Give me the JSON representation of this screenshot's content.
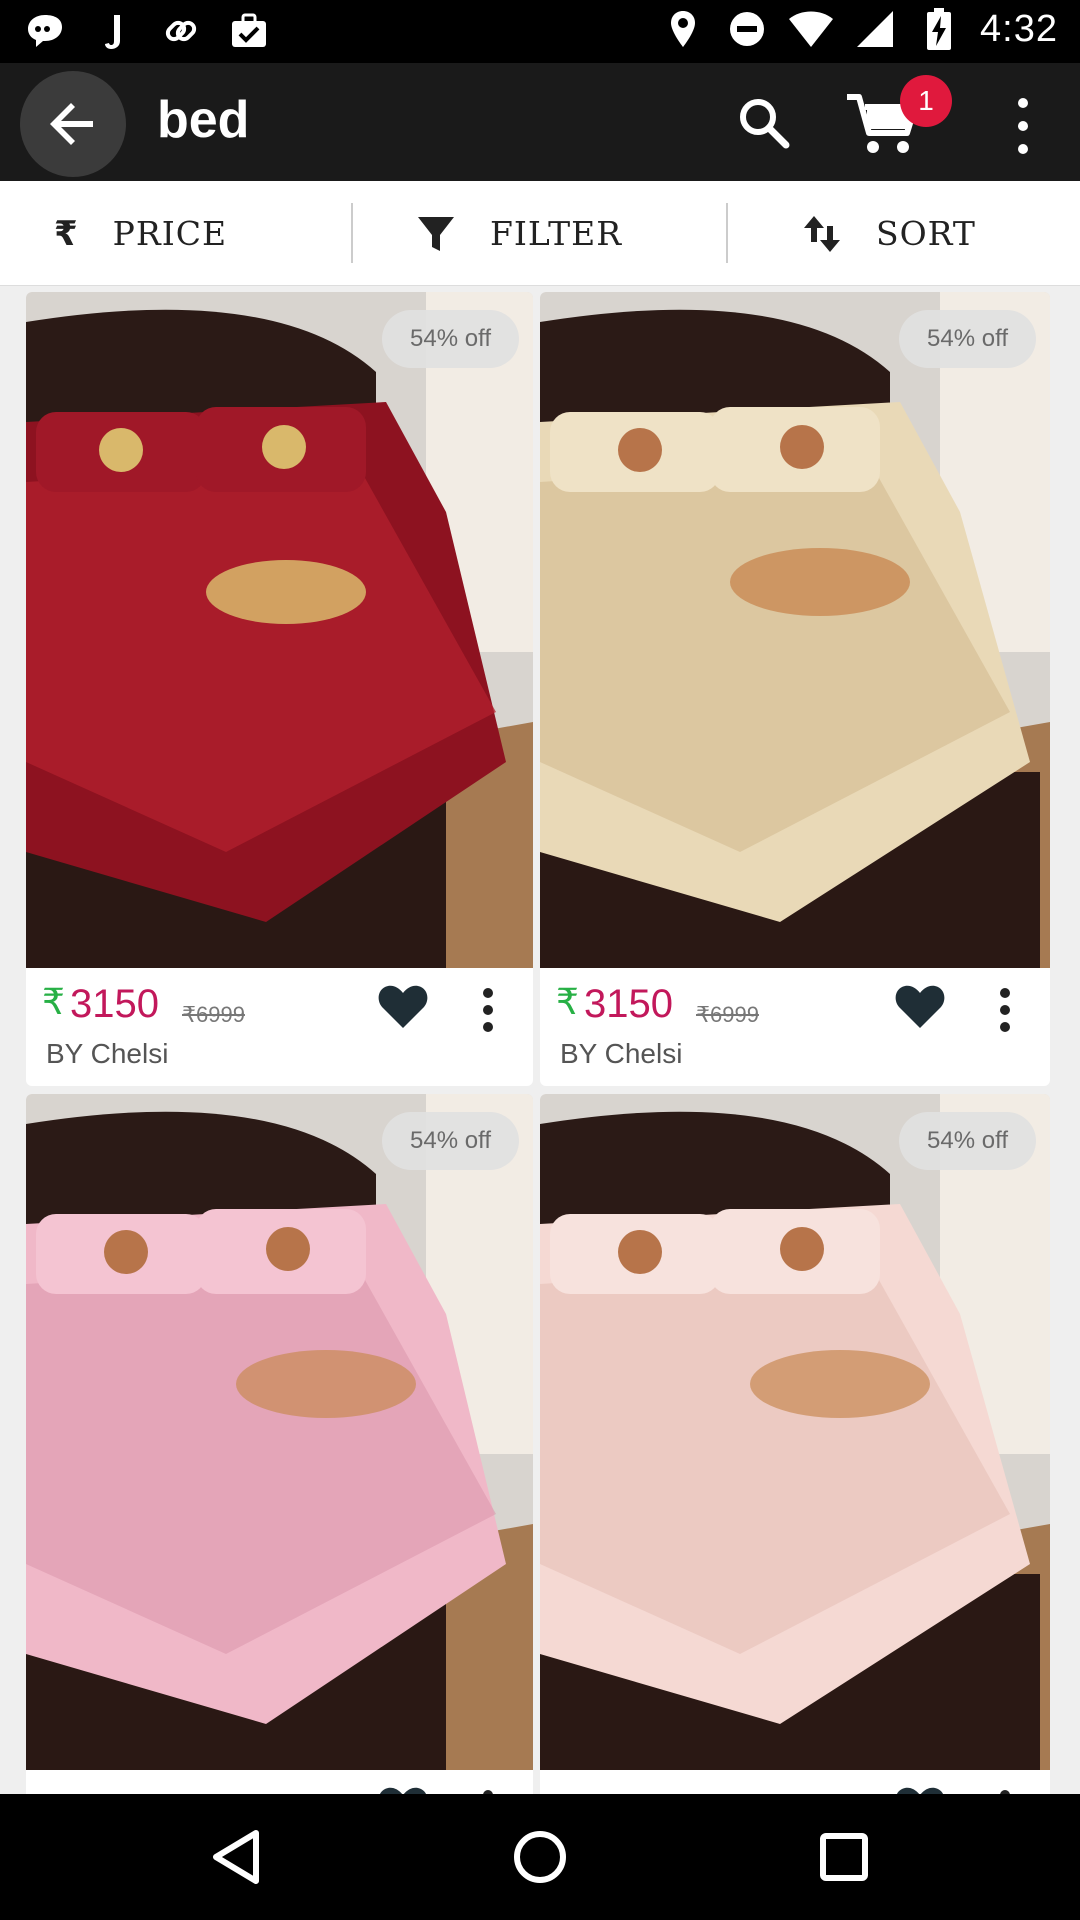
{
  "status_bar": {
    "time": "4:32",
    "left_icons": [
      "chat-icon",
      "music-note-icon",
      "link-icon",
      "briefcase-check-icon"
    ],
    "right_icons": [
      "location-icon",
      "do-not-disturb-icon",
      "wifi-icon",
      "signal-icon",
      "battery-charging-icon"
    ]
  },
  "toolbar": {
    "search_query": "bed",
    "cart_count": "1"
  },
  "actions": {
    "price_label": "PRICE",
    "filter_label": "FILTER",
    "sort_label": "SORT",
    "rupee_symbol": "₹"
  },
  "products": [
    {
      "discount": "54% off",
      "currency": "₹",
      "price": "3150",
      "mrp": "₹6999",
      "brand": "BY Chelsi",
      "color": "#8d1220",
      "accent": "#b3202d"
    },
    {
      "discount": "54% off",
      "currency": "₹",
      "price": "3150",
      "mrp": "₹6999",
      "brand": "BY Chelsi",
      "color": "#e9d9b7",
      "accent": "#d6bf95"
    },
    {
      "discount": "54% off",
      "currency": "₹",
      "price": "",
      "mrp": "",
      "brand": "",
      "color": "#f0b8c8",
      "accent": "#dc98ad"
    },
    {
      "discount": "54% off",
      "currency": "₹",
      "price": "",
      "mrp": "",
      "brand": "",
      "color": "#f5d9d3",
      "accent": "#e6bfb7"
    }
  ],
  "colors": {
    "price": "#c2185b",
    "rupee_green": "#27b045",
    "badge_red": "#e0193d",
    "toolbar": "#1a1a1a"
  },
  "nav_bar": {
    "icons": [
      "back-triangle-icon",
      "home-circle-icon",
      "recents-square-icon"
    ]
  }
}
